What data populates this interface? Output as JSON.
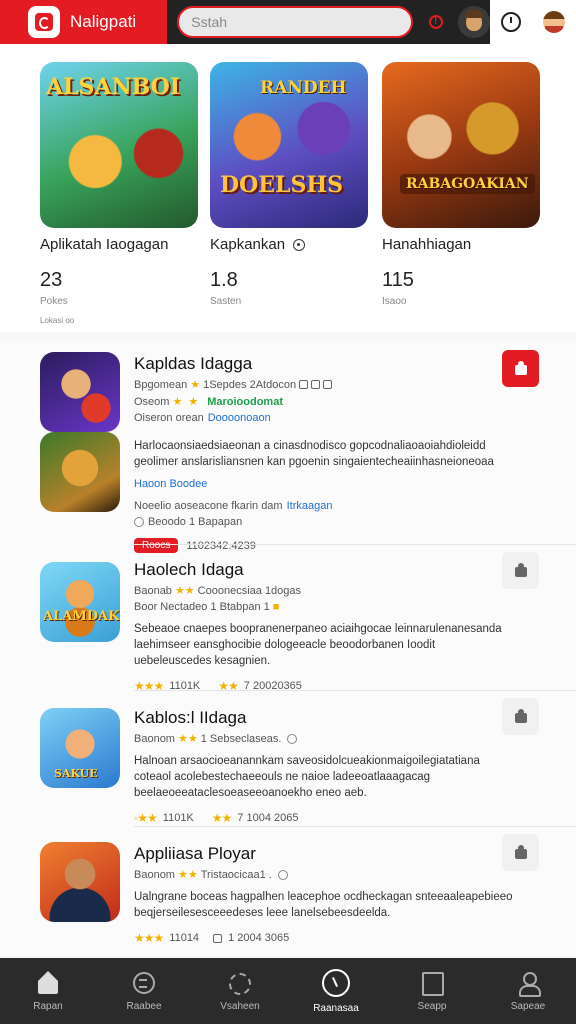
{
  "header": {
    "app_title": "Naligpati",
    "search_placeholder": "Sstah"
  },
  "featured": [
    {
      "art_title": "ALSANBOI",
      "name": "Aplikatah Iaogagan",
      "count": "23",
      "unit": "Pokes",
      "has_info": false
    },
    {
      "art_title": "RANDEH",
      "art_subtitle": "DOELSHS",
      "name": "Kapkankan",
      "count": "1.8",
      "unit": "Sasten",
      "has_info": true
    },
    {
      "art_title": "RABAGOAKIAN",
      "name": "Hanahhiagan",
      "count": "115",
      "unit": "Isaoo",
      "has_info": false
    }
  ],
  "featured_more": "Lokasi oo",
  "apps": [
    {
      "title": "Kapldas Idagga",
      "meta1": "Bpgomean",
      "meta1_rest": "1Sepdes 2Atdocon",
      "meta2": "Oseom",
      "meta2_green": "Maroioodomat",
      "meta3": "Oiseron orean",
      "meta3_blue": "Doooonoaon",
      "desc": "Harlocaonsiaedsiaeonan a cinasdnodisco gopcodnaliaoaoiahdioleidd geolimer anslarisliansnen kan pgoenin singaientecheaiinhasneioneoaa",
      "link_label": "Haoon Boodee",
      "note": "Noeelio aoseacone fkarin dam",
      "note_link": "Itrkaagan",
      "note2": "Beoodo 1 Bapapan",
      "pill": "Roocs",
      "date": "1102342.4239"
    },
    {
      "title": "Haolech Idaga",
      "meta1": "Baonab",
      "meta1_rest": "Cooonecsiaa 1dogas",
      "meta2": "Boor Nectadeo 1 Btabpan 1",
      "desc": "Sebeaoe cnaepes boopranenerpaneo aciaihgocae leinnarulenanesanda laehimseer eansghocibie dologeeacle beoodorbanen Ioodit uebeleuscedes kesagnien.",
      "rating_a": "1101K",
      "rating_b": "7 20020365",
      "art_tag": "ALAMDAK"
    },
    {
      "title": "Kablos:l IIdaga",
      "meta1": "Baonom",
      "meta1_rest": "1 Sebseclaseas.",
      "desc": "Halnoan arsaocioeanannkam saveosidolcueakionmaigoilegiatatiana coteaol acolebestechaeeouls ne naioe ladeeoatlaaagacag beelaeoeeataclesoeaseeoanoekho eneo aeb.",
      "rating_a": "1101K",
      "rating_b": "7 1004 2065",
      "art_tag": "SAKUE"
    },
    {
      "title": "Appliiasa Ployar",
      "meta1": "Baonom",
      "meta1_rest": "Tristaocicaa1 .",
      "desc": "Ualngrane boceas hagpalhen leacephoe ocdheckagan snteeaaleapebieeo beqjerseilesesceeedeses leee lanelsebeesdeelda.",
      "rating_a": "11014",
      "rating_b": "1 2004 3065"
    }
  ],
  "bottom_nav": [
    {
      "label": "Rapan",
      "icon": "home-icon"
    },
    {
      "label": "Raabee",
      "icon": "category-icon"
    },
    {
      "label": "Vsaheen",
      "icon": "games-icon"
    },
    {
      "label": "Raanasaa",
      "icon": "explore-icon",
      "active": true
    },
    {
      "label": "Seapp",
      "icon": "apps-icon"
    },
    {
      "label": "Sapeae",
      "icon": "profile-icon"
    }
  ],
  "colors": {
    "accent": "#e31b23",
    "topbar": "#222222",
    "star": "#f2b200",
    "green": "#1e9e4a",
    "link": "#1f6fd1"
  }
}
